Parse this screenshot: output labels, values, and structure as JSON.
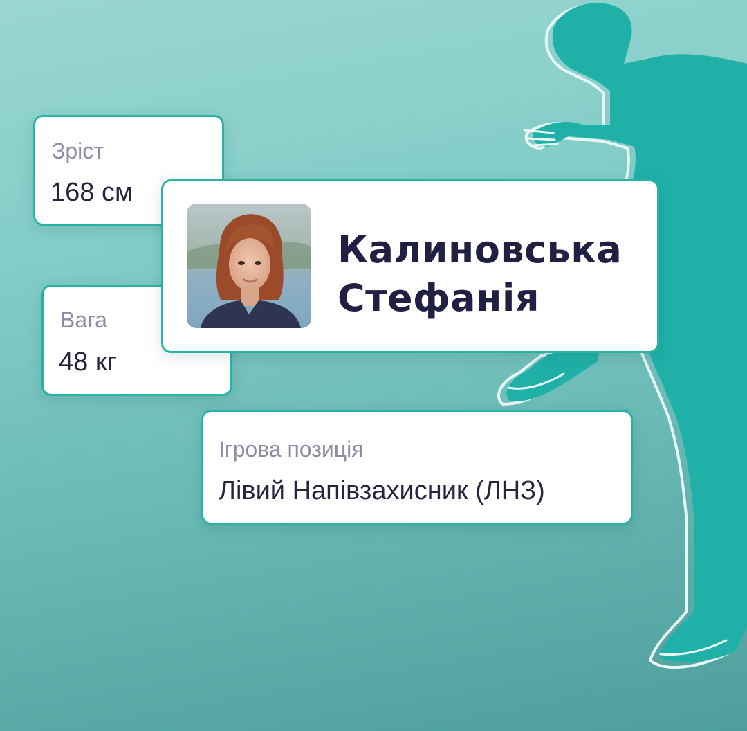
{
  "player": {
    "first_name_line": "Калиновська",
    "second_name_line": "Стефанія",
    "photo": "portrait-photo"
  },
  "stats": {
    "height": {
      "label": "Зріст",
      "value": "168 см"
    },
    "weight": {
      "label": "Вага",
      "value": "48 кг"
    },
    "position": {
      "label": "Ігрова позиція",
      "value": "Лівий Напівзахисник (ЛНЗ)"
    }
  },
  "colors": {
    "background_top": "#9ad6d2",
    "background_bottom": "#4e9f9c",
    "silhouette": "#1fb0a8",
    "card_border": "#29b3a7",
    "label_text": "#8d8ba6",
    "value_text": "#252441"
  },
  "icons": [
    "footballer-silhouette"
  ]
}
